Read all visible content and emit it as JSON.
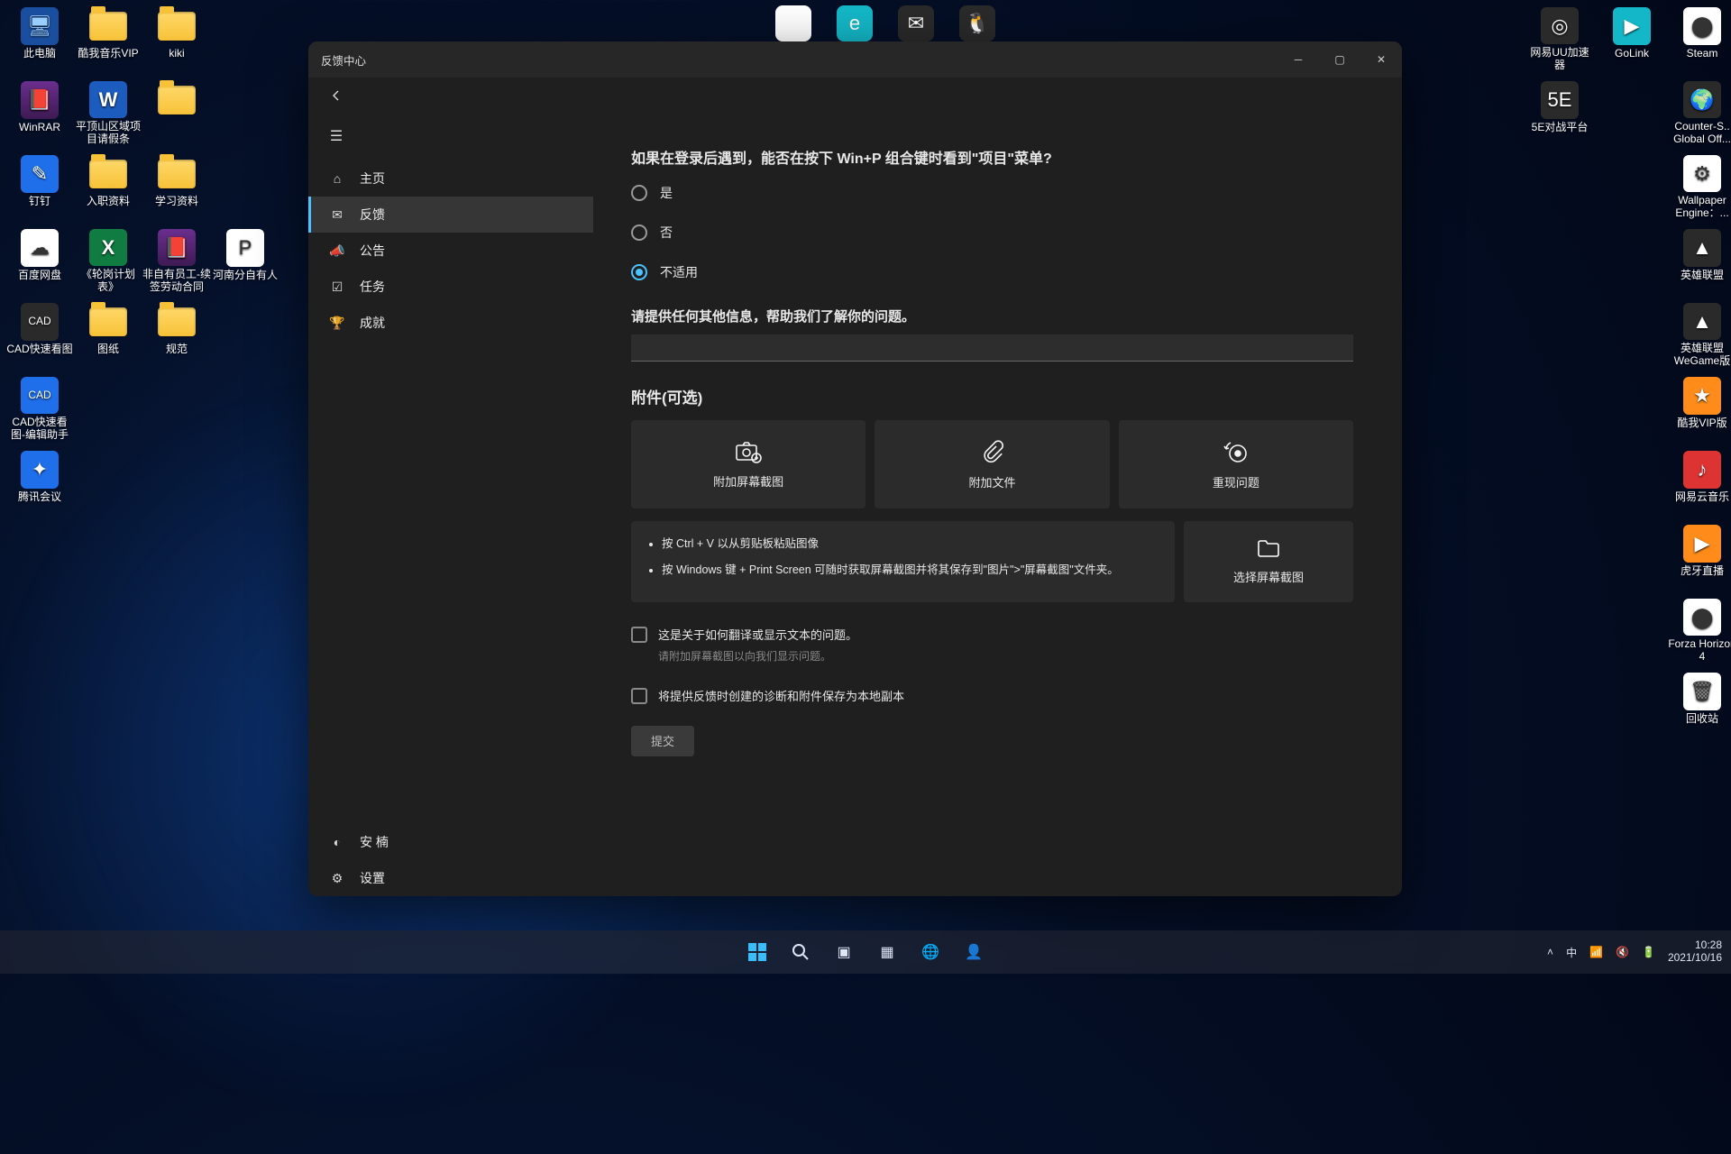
{
  "desktop": {
    "leftColumns": [
      [
        {
          "label": "此电脑",
          "cls": "mono",
          "glyph": "🖥"
        },
        {
          "label": "WinRAR",
          "cls": "rar",
          "glyph": "📕"
        },
        {
          "label": "钉钉",
          "cls": "blue",
          "glyph": "✎"
        },
        {
          "label": "百度网盘",
          "cls": "white",
          "glyph": "☁"
        },
        {
          "label": "CAD快速看图",
          "cls": "generic",
          "glyph": "CAD"
        },
        {
          "label": "CAD快速看图-编辑助手",
          "cls": "blue",
          "glyph": "CAD"
        },
        {
          "label": "腾讯会议",
          "cls": "blue",
          "glyph": "✦"
        }
      ],
      [
        {
          "label": "酷我音乐VIP",
          "cls": "folder"
        },
        {
          "label": "平顶山区域项目请假条",
          "cls": "word",
          "glyph": "W"
        },
        {
          "label": "入职资料",
          "cls": "folder"
        },
        {
          "label": "《轮岗计划表》",
          "cls": "xls",
          "glyph": "X"
        },
        {
          "label": "图纸",
          "cls": "folder"
        }
      ],
      [
        {
          "label": "kiki",
          "cls": "folder"
        },
        {
          "label": "",
          "cls": "folder"
        },
        {
          "label": "学习资料",
          "cls": "folder"
        },
        {
          "label": "非自有员工-续签劳动合同",
          "cls": "rar",
          "glyph": "📕"
        },
        {
          "label": "规范",
          "cls": "folder"
        }
      ],
      [
        {
          "label": "",
          "cls": "none"
        },
        {
          "label": "",
          "cls": "none"
        },
        {
          "label": "",
          "cls": "none"
        },
        {
          "label": "河南分自有人",
          "cls": "white",
          "glyph": "P"
        }
      ]
    ],
    "rightColumns": [
      [
        {
          "label": "网易UU加速器",
          "cls": "generic",
          "glyph": "◎"
        },
        {
          "label": "5E对战平台",
          "cls": "generic",
          "glyph": "5E"
        }
      ],
      [
        {
          "label": "GoLink",
          "cls": "teal",
          "glyph": "▶"
        }
      ],
      [
        {
          "label": "Steam",
          "cls": "white",
          "glyph": "⬤"
        },
        {
          "label": "Counter-S.. Global Off...",
          "cls": "generic",
          "glyph": "🌍"
        },
        {
          "label": "Wallpaper Engine：...",
          "cls": "white",
          "glyph": "⚙"
        },
        {
          "label": "英雄联盟",
          "cls": "generic",
          "glyph": "▲"
        },
        {
          "label": "英雄联盟WeGame版",
          "cls": "generic",
          "glyph": "▲"
        },
        {
          "label": "酷我VIP版",
          "cls": "orange",
          "glyph": "★"
        },
        {
          "label": "网易云音乐",
          "cls": "red",
          "glyph": "♪"
        },
        {
          "label": "虎牙直播",
          "cls": "orange",
          "glyph": "▶"
        },
        {
          "label": "Forza Horizon 4",
          "cls": "white",
          "glyph": "⬤"
        },
        {
          "label": "回收站",
          "cls": "white",
          "glyph": "🗑"
        }
      ]
    ],
    "topIcons": [
      {
        "name": "chrome",
        "cls": "white",
        "glyph": "◉"
      },
      {
        "name": "edge",
        "cls": "teal",
        "glyph": "e"
      },
      {
        "name": "wechat",
        "cls": "generic",
        "glyph": "✉"
      },
      {
        "name": "qq",
        "cls": "generic",
        "glyph": "🐧"
      }
    ]
  },
  "window": {
    "title": "反馈中心",
    "sidebar": [
      {
        "icon": "⌂",
        "label": "主页"
      },
      {
        "icon": "✉",
        "label": "反馈",
        "active": true
      },
      {
        "icon": "📣",
        "label": "公告"
      },
      {
        "icon": "☑",
        "label": "任务"
      },
      {
        "icon": "🏆",
        "label": "成就"
      }
    ],
    "user": "安 楠",
    "settings": "设置",
    "question": "如果在登录后遇到，能否在按下 Win+P 组合键时看到\"项目\"菜单?",
    "options": {
      "yes": "是",
      "no": "否",
      "na": "不适用"
    },
    "selected": "na",
    "moreInfoLabel": "请提供任何其他信息，帮助我们了解你的问题。",
    "attachments": {
      "title": "附件(可选)",
      "screenshot": "附加屏幕截图",
      "file": "附加文件",
      "recreate": "重现问题",
      "tip1": "按 Ctrl + V 以从剪贴板粘贴图像",
      "tip2": "按 Windows 键 + Print Screen 可随时获取屏幕截图并将其保存到\"图片\">\"屏幕截图\"文件夹。",
      "choose": "选择屏幕截图"
    },
    "checkbox1": "这是关于如何翻译或显示文本的问题。",
    "checkbox1hint": "请附加屏幕截图以向我们显示问题。",
    "checkbox2": "将提供反馈时创建的诊断和附件保存为本地副本",
    "submit": "提交"
  },
  "taskbar": {
    "ime": "中",
    "time": "10:28",
    "date": "2021/10/16"
  }
}
